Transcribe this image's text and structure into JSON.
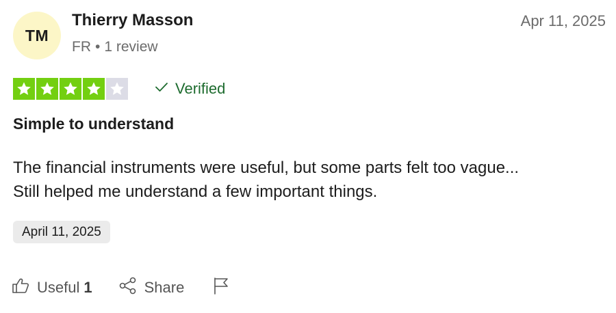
{
  "review": {
    "author": {
      "initials": "TM",
      "name": "Thierry Masson",
      "country": "FR",
      "separator": "•",
      "review_count_text": "1 review"
    },
    "posted_date": "Apr 11, 2025",
    "rating": {
      "value": 4,
      "max": 5,
      "filled_color": "#73cf11",
      "empty_color": "#dcdce6"
    },
    "verified_label": "Verified",
    "title": "Simple to understand",
    "body_lines": [
      "The financial instruments were useful, but some parts felt too vague...",
      "Still helped me understand a few important things."
    ],
    "experience_date": "April 11, 2025",
    "actions": {
      "useful_label": "Useful",
      "useful_count": "1",
      "share_label": "Share",
      "flag_icon": "flag-icon"
    }
  }
}
